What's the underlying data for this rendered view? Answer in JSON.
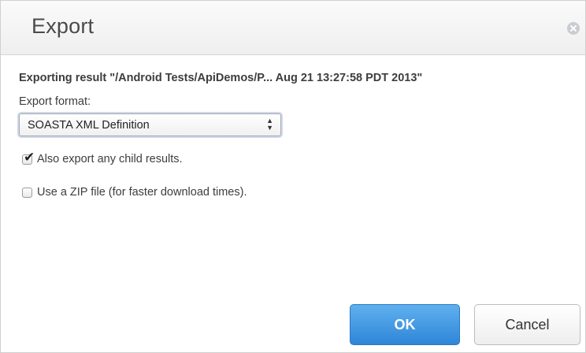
{
  "dialog": {
    "title": "Export",
    "close_icon": "close-circle-icon",
    "exporting_text": "Exporting result \"/Android Tests/ApiDemos/P... Aug 21 13:27:58 PDT 2013\"",
    "format_label": "Export format:",
    "format_select": {
      "value": "SOASTA XML Definition",
      "arrows": "▲▼"
    },
    "options": [
      {
        "label": "Also export any child results.",
        "checked": true
      },
      {
        "label": "Use a ZIP file (for faster download times).",
        "checked": false
      }
    ],
    "buttons": {
      "ok_label": "OK",
      "cancel_label": "Cancel"
    }
  },
  "colors": {
    "primary_button": "#3a91e0",
    "title_bar": "#f4f4f4"
  }
}
